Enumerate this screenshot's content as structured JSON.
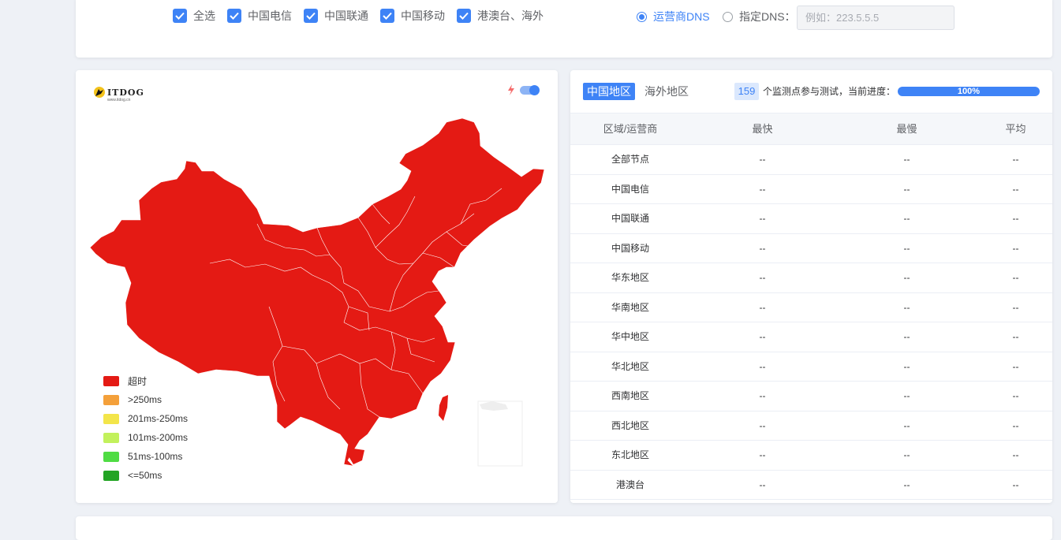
{
  "filters": {
    "checkboxes": [
      {
        "label": "全选",
        "checked": true
      },
      {
        "label": "中国电信",
        "checked": true
      },
      {
        "label": "中国联通",
        "checked": true
      },
      {
        "label": "中国移动",
        "checked": true
      },
      {
        "label": "港澳台、海外",
        "checked": true
      }
    ],
    "dns_options": [
      {
        "label": "运营商DNS",
        "selected": true
      },
      {
        "label": "指定DNS：",
        "selected": false
      }
    ],
    "dns_placeholder": "例如：223.5.5.5"
  },
  "map": {
    "logo_text": "ITDOG",
    "logo_subtext": "www.itdog.cn",
    "fill_color": "#e41a14",
    "legend": [
      {
        "label": "超时",
        "color": "#e41a14"
      },
      {
        "label": ">250ms",
        "color": "#f4a03a"
      },
      {
        "label": "201ms-250ms",
        "color": "#f3e54a"
      },
      {
        "label": "101ms-200ms",
        "color": "#c2f15c"
      },
      {
        "label": "51ms-100ms",
        "color": "#4fdc43"
      },
      {
        "label": "<=50ms",
        "color": "#23a424"
      }
    ]
  },
  "results": {
    "tabs": [
      "中国地区",
      "海外地区"
    ],
    "active_tab": "中国地区",
    "node_count": "159",
    "node_count_text": "个监测点参与测试，当前进度：",
    "progress_label": "100%",
    "progress_value": 100,
    "columns": [
      "区域/运营商",
      "最快",
      "最慢",
      "平均"
    ],
    "rows": [
      [
        "全部节点",
        "--",
        "--",
        "--"
      ],
      [
        "中国电信",
        "--",
        "--",
        "--"
      ],
      [
        "中国联通",
        "--",
        "--",
        "--"
      ],
      [
        "中国移动",
        "--",
        "--",
        "--"
      ],
      [
        "华东地区",
        "--",
        "--",
        "--"
      ],
      [
        "华南地区",
        "--",
        "--",
        "--"
      ],
      [
        "华中地区",
        "--",
        "--",
        "--"
      ],
      [
        "华北地区",
        "--",
        "--",
        "--"
      ],
      [
        "西南地区",
        "--",
        "--",
        "--"
      ],
      [
        "西北地区",
        "--",
        "--",
        "--"
      ],
      [
        "东北地区",
        "--",
        "--",
        "--"
      ],
      [
        "港澳台",
        "--",
        "--",
        "--"
      ]
    ]
  },
  "colors": {
    "accent": "#3e83f6",
    "timeout": "#e41a14"
  }
}
